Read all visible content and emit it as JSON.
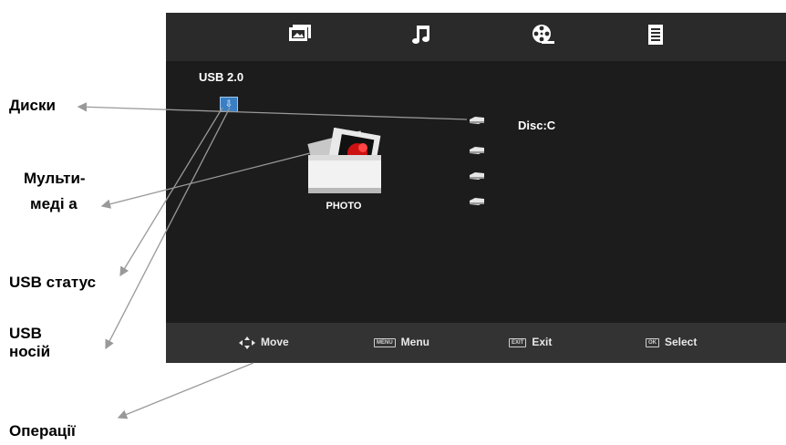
{
  "tabs": [
    {
      "name": "photo-tab",
      "icon": "photo-icon"
    },
    {
      "name": "music-tab",
      "icon": "music-note-icon"
    },
    {
      "name": "movie-tab",
      "icon": "film-reel-icon"
    },
    {
      "name": "text-tab",
      "icon": "document-icon"
    }
  ],
  "usb": {
    "label": "USB 2.0",
    "icon": "usb-icon"
  },
  "media": {
    "label": "PHOTO",
    "icon": "photo-folder-icon"
  },
  "disk": {
    "label": "Disc:C",
    "icon": "disk-icon"
  },
  "footer": {
    "move": {
      "key": "",
      "label": "Move"
    },
    "menu": {
      "key": "MENU",
      "label": "Menu"
    },
    "exit": {
      "key": "EXIT",
      "label": "Exit"
    },
    "select": {
      "key": "OK",
      "label": "Select"
    }
  },
  "annotations": {
    "disks": "Диски",
    "multimedia_1": "Мульти-",
    "multimedia_2": "меді а",
    "usb_status": "USB статус",
    "usb_carrier_1": "USB",
    "usb_carrier_2": "носій",
    "operations": "Операції"
  },
  "colors": {
    "screen": "#1c1c1c",
    "topbar": "#2a2a2a",
    "footer": "#333333",
    "usb_icon": "#3a7fc4",
    "arrow": "#999999"
  }
}
